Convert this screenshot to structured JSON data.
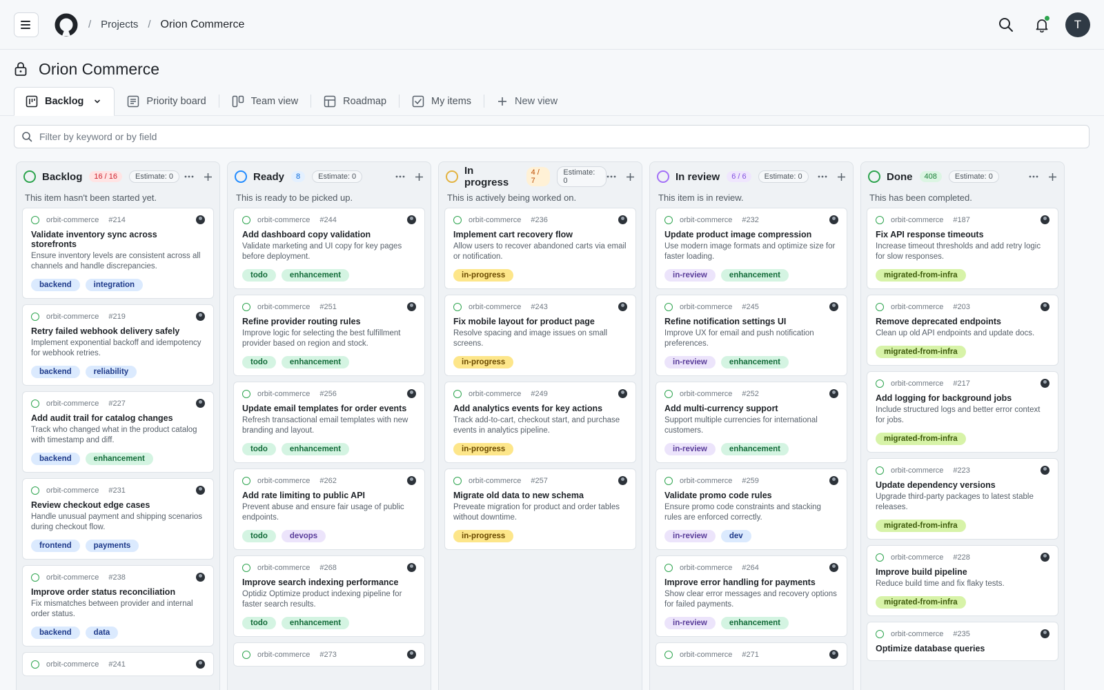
{
  "breadcrumb": [
    "Projects",
    "Orion Commerce"
  ],
  "header": {
    "avatar_initial": "T"
  },
  "page": {
    "title": "Orion Commerce"
  },
  "tabs": [
    {
      "label": "Backlog",
      "icon": "board-icon"
    },
    {
      "label": "Priority board",
      "icon": "table-icon"
    },
    {
      "label": "Team view",
      "icon": "team-board-icon"
    },
    {
      "label": "Roadmap",
      "icon": "roadmap-icon"
    },
    {
      "label": "My items",
      "icon": "checkbox-icon"
    },
    {
      "label": "New view",
      "icon": "plus-icon"
    }
  ],
  "filter": {
    "placeholder": "Filter by keyword or by field"
  },
  "colors": {
    "green": "#2da44e",
    "blue": "#218bff",
    "yellow": "#e3b341",
    "purple": "#a371f7"
  },
  "columns": [
    {
      "name": "Backlog",
      "count": "16 / 16",
      "estimate": "Estimate: 0",
      "description": "This item hasn't been started yet.",
      "cards": [
        {
          "repo": "orbit-commerce",
          "num": "#214",
          "title": "Validate inventory sync across storefronts",
          "desc": "Ensure inventory levels are consistent across all channels and handle discrepancies.",
          "labels": [
            "backend",
            "integration"
          ]
        },
        {
          "repo": "orbit-commerce",
          "num": "#219",
          "title": "Retry failed webhook delivery safely",
          "desc": "Implement exponential backoff and idempotency for webhook retries.",
          "labels": [
            "backend",
            "reliability"
          ]
        },
        {
          "repo": "orbit-commerce",
          "num": "#227",
          "title": "Add audit trail for catalog changes",
          "desc": "Track who changed what in the product catalog with timestamp and diff.",
          "labels": [
            "backend",
            "enhancement"
          ]
        },
        {
          "repo": "orbit-commerce",
          "num": "#231",
          "title": "Review checkout edge cases",
          "desc": "Handle unusual payment and shipping scenarios during checkout flow.",
          "labels": [
            "frontend",
            "payments"
          ]
        },
        {
          "repo": "orbit-commerce",
          "num": "#238",
          "title": "Improve order status reconciliation",
          "desc": "Fix mismatches between provider and internal order status.",
          "labels": [
            "backend",
            "data"
          ]
        },
        {
          "repo": "orbit-commerce",
          "num": "#241",
          "title": "",
          "desc": "",
          "labels": []
        }
      ]
    },
    {
      "name": "Ready",
      "count": "8",
      "estimate": "Estimate: 0",
      "description": "This is ready to be picked up.",
      "cards": [
        {
          "repo": "orbit-commerce",
          "num": "#244",
          "title": "Add dashboard copy validation",
          "desc": "Validate marketing and UI copy for key pages before deployment.",
          "labels": [
            "todo",
            "enhancement"
          ]
        },
        {
          "repo": "orbit-commerce",
          "num": "#251",
          "title": "Refine provider routing rules",
          "desc": "Improve logic for selecting the best fulfillment provider based on region and stock.",
          "labels": [
            "todo",
            "enhancement"
          ]
        },
        {
          "repo": "orbit-commerce",
          "num": "#256",
          "title": "Update email templates for order events",
          "desc": "Refresh transactional email templates with new branding and layout.",
          "labels": [
            "todo",
            "enhancement"
          ]
        },
        {
          "repo": "orbit-commerce",
          "num": "#262",
          "title": "Add rate limiting to public API",
          "desc": "Prevent abuse and ensure fair usage of public endpoints.",
          "labels": [
            "todo",
            "devops"
          ]
        },
        {
          "repo": "orbit-commerce",
          "num": "#268",
          "title": "Improve search indexing performance",
          "desc": "Optidiz Optimize product indexing pipeline for faster search results.",
          "labels": [
            "todo",
            "enhancement"
          ]
        },
        {
          "repo": "orbit-commerce",
          "num": "#273",
          "title": "",
          "desc": "",
          "labels": []
        }
      ]
    },
    {
      "name": "In progress",
      "count": "4 / 7",
      "estimate": "Estimate: 0",
      "description": "This is actively being worked on.",
      "cards": [
        {
          "repo": "orbit-commerce",
          "num": "#236",
          "title": "Implement cart recovery flow",
          "desc": "Allow users to recover abandoned carts via email or notification.",
          "labels": [
            "in-progress"
          ]
        },
        {
          "repo": "orbit-commerce",
          "num": "#243",
          "title": "Fix mobile layout for product page",
          "desc": "Resolve spacing and image issues on small screens.",
          "labels": [
            "in-progress"
          ]
        },
        {
          "repo": "orbit-commerce",
          "num": "#249",
          "title": "Add analytics events for key actions",
          "desc": "Track add-to-cart, checkout start, and purchase events in analytics pipeline.",
          "labels": [
            "in-progress"
          ]
        },
        {
          "repo": "orbit-commerce",
          "num": "#257",
          "title": "Migrate old data to new schema",
          "desc": "Preveate migration for product and order tables without downtime.",
          "labels": [
            "in-progress"
          ]
        }
      ]
    },
    {
      "name": "In review",
      "count": "6 / 6",
      "estimate": "Estimate: 0",
      "description": "This item is in review.",
      "cards": [
        {
          "repo": "orbit-commerce",
          "num": "#232",
          "title": "Update product image compression",
          "desc": "Use modern image formats and optimize size for faster loading.",
          "labels": [
            "in-review",
            "enhancement"
          ]
        },
        {
          "repo": "orbit-commerce",
          "num": "#245",
          "title": "Refine notification settings UI",
          "desc": "Improve UX for email and push notification preferences.",
          "labels": [
            "in-review",
            "enhancement"
          ]
        },
        {
          "repo": "orbit-commerce",
          "num": "#252",
          "title": "Add multi-currency support",
          "desc": "Support multiple currencies for international customers.",
          "labels": [
            "in-review",
            "enhancement"
          ]
        },
        {
          "repo": "orbit-commerce",
          "num": "#259",
          "title": "Validate promo code rules",
          "desc": "Ensure promo code constraints and stacking rules are enforced correctly.",
          "labels": [
            "in-review",
            "dev"
          ]
        },
        {
          "repo": "orbit-commerce",
          "num": "#264",
          "title": "Improve error handling for payments",
          "desc": "Show clear error messages and recovery options for failed payments.",
          "labels": [
            "in-review",
            "enhancement"
          ]
        },
        {
          "repo": "orbit-commerce",
          "num": "#271",
          "title": "",
          "desc": "",
          "labels": []
        }
      ]
    },
    {
      "name": "Done",
      "count": "408",
      "estimate": "Estimate: 0",
      "description": "This has been completed.",
      "cards": [
        {
          "repo": "orbit-commerce",
          "num": "#187",
          "title": "Fix API response timeouts",
          "desc": "Increase timeout thresholds and add retry logic for slow responses.",
          "labels": [
            "migrated-from-infra"
          ]
        },
        {
          "repo": "orbit-commerce",
          "num": "#203",
          "title": "Remove deprecated endpoints",
          "desc": "Clean up old API endpoints and update docs.",
          "labels": [
            "migrated-from-infra"
          ]
        },
        {
          "repo": "orbit-commerce",
          "num": "#217",
          "title": "Add logging for background jobs",
          "desc": "Include structured logs and better error context for jobs.",
          "labels": [
            "migrated-from-infra"
          ]
        },
        {
          "repo": "orbit-commerce",
          "num": "#223",
          "title": "Update dependency versions",
          "desc": "Upgrade third-party packages to latest stable releases.",
          "labels": [
            "migrated-from-infra"
          ]
        },
        {
          "repo": "orbit-commerce",
          "num": "#228",
          "title": "Improve build pipeline",
          "desc": "Reduce build time and fix flaky tests.",
          "labels": [
            "migrated-from-infra"
          ]
        },
        {
          "repo": "orbit-commerce",
          "num": "#235",
          "title": "Optimize database queries",
          "desc": "",
          "labels": []
        }
      ]
    }
  ]
}
